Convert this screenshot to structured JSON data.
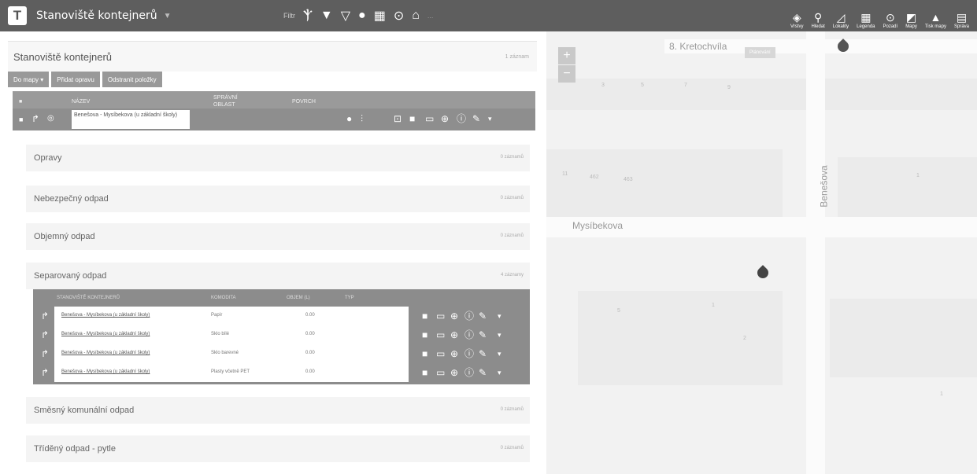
{
  "topbar": {
    "logo_letter": "T",
    "title": "Stanoviště kontejnerů",
    "tools": [
      "Filtr",
      "Ⲯ",
      "▼",
      "▽",
      "●",
      "▦",
      "⊙",
      "⌂"
    ],
    "faint_text": "...",
    "right_buttons": [
      {
        "icon": "layers-icon",
        "glyph": "◈",
        "label": "Vrstvy"
      },
      {
        "icon": "search-icon",
        "glyph": "⚲",
        "label": "Hledat"
      },
      {
        "icon": "measure-icon",
        "glyph": "◿",
        "label": "Lokality"
      },
      {
        "icon": "legend-icon",
        "glyph": "▦",
        "label": "Legenda"
      },
      {
        "icon": "marker-icon",
        "glyph": "⊙",
        "label": "Pozadí"
      },
      {
        "icon": "map-icon",
        "glyph": "◩",
        "label": "Mapy"
      },
      {
        "icon": "print-icon",
        "glyph": "▲",
        "label": "Tisk mapy"
      },
      {
        "icon": "admin-icon",
        "glyph": "▤",
        "label": "Správa"
      }
    ]
  },
  "panel": {
    "title": "Stanoviště kontejnerů",
    "count": "1 záznam",
    "buttons": [
      "Do mapy ▾",
      "Přidat opravu",
      "Odstranit položky"
    ],
    "columns": [
      "NÁZEV",
      "SPRÁVNÍ OBLAST",
      "POVRCH"
    ],
    "main_row": {
      "name": "Benešova - Mysíbekova (u základní školy)"
    }
  },
  "sections": [
    {
      "title": "Opravy",
      "count": "0 záznamů"
    },
    {
      "title": "Nebezpečný odpad",
      "count": "0 záznamů"
    },
    {
      "title": "Objemný odpad",
      "count": "0 záznamů"
    },
    {
      "title": "Separovaný odpad",
      "count": "4 záznamy"
    },
    {
      "title": "Směsný komunální odpad",
      "count": "0 záznamů"
    },
    {
      "title": "Tříděný odpad - pytle",
      "count": "0 záznamů"
    }
  ],
  "sub_table": {
    "columns": [
      "STANOVIŠTĚ KONTEJNERŮ",
      "KOMODITA",
      "OBJEM (L)",
      "TYP"
    ],
    "rows": [
      {
        "station": "Benešova - Mysíbekova (u základní školy)",
        "commodity": "Papír",
        "volume": "0.00"
      },
      {
        "station": "Benešova - Mysíbekova (u základní školy)",
        "commodity": "Sklo bílé",
        "volume": "0.00"
      },
      {
        "station": "Benešova - Mysíbekova (u základní školy)",
        "commodity": "Sklo barevné",
        "volume": "0.00"
      },
      {
        "station": "Benešova - Mysíbekova (u základní školy)",
        "commodity": "Plasty včetně PET",
        "volume": "0.00"
      }
    ]
  },
  "map": {
    "street_top": "8. Kretochvíla",
    "street_right": "Benešova",
    "street_left": "Mysíbekova",
    "plan_button": "Plánování",
    "zoom_in": "+",
    "zoom_out": "−",
    "numbers": [
      "3",
      "5",
      "7",
      "9",
      "11",
      "462",
      "463",
      "1",
      "5",
      "1",
      "2",
      "1"
    ]
  }
}
